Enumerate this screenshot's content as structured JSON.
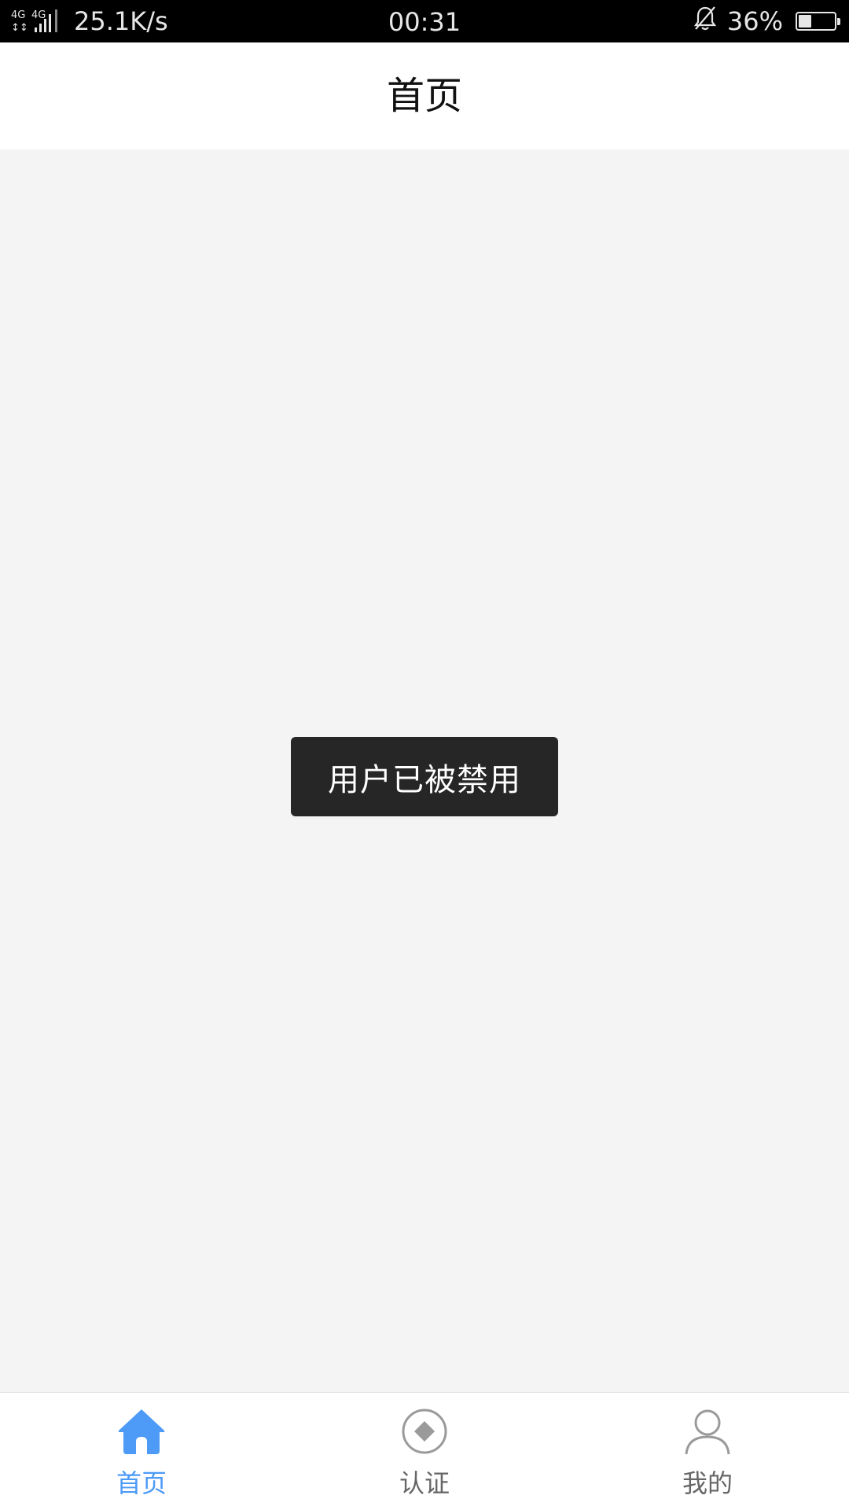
{
  "status_bar": {
    "network_type": "4G",
    "net_speed": "25.1K/s",
    "time": "00:31",
    "battery_percent": "36%",
    "battery_level": 0.36
  },
  "header": {
    "title": "首页"
  },
  "toast": {
    "message": "用户已被禁用"
  },
  "tab_bar": {
    "active_color": "#4d9af7",
    "inactive_color": "#666666",
    "tabs": [
      {
        "label": "首页",
        "icon": "home-icon",
        "active": true
      },
      {
        "label": "认证",
        "icon": "certify-icon",
        "active": false
      },
      {
        "label": "我的",
        "icon": "user-icon",
        "active": false
      }
    ]
  }
}
